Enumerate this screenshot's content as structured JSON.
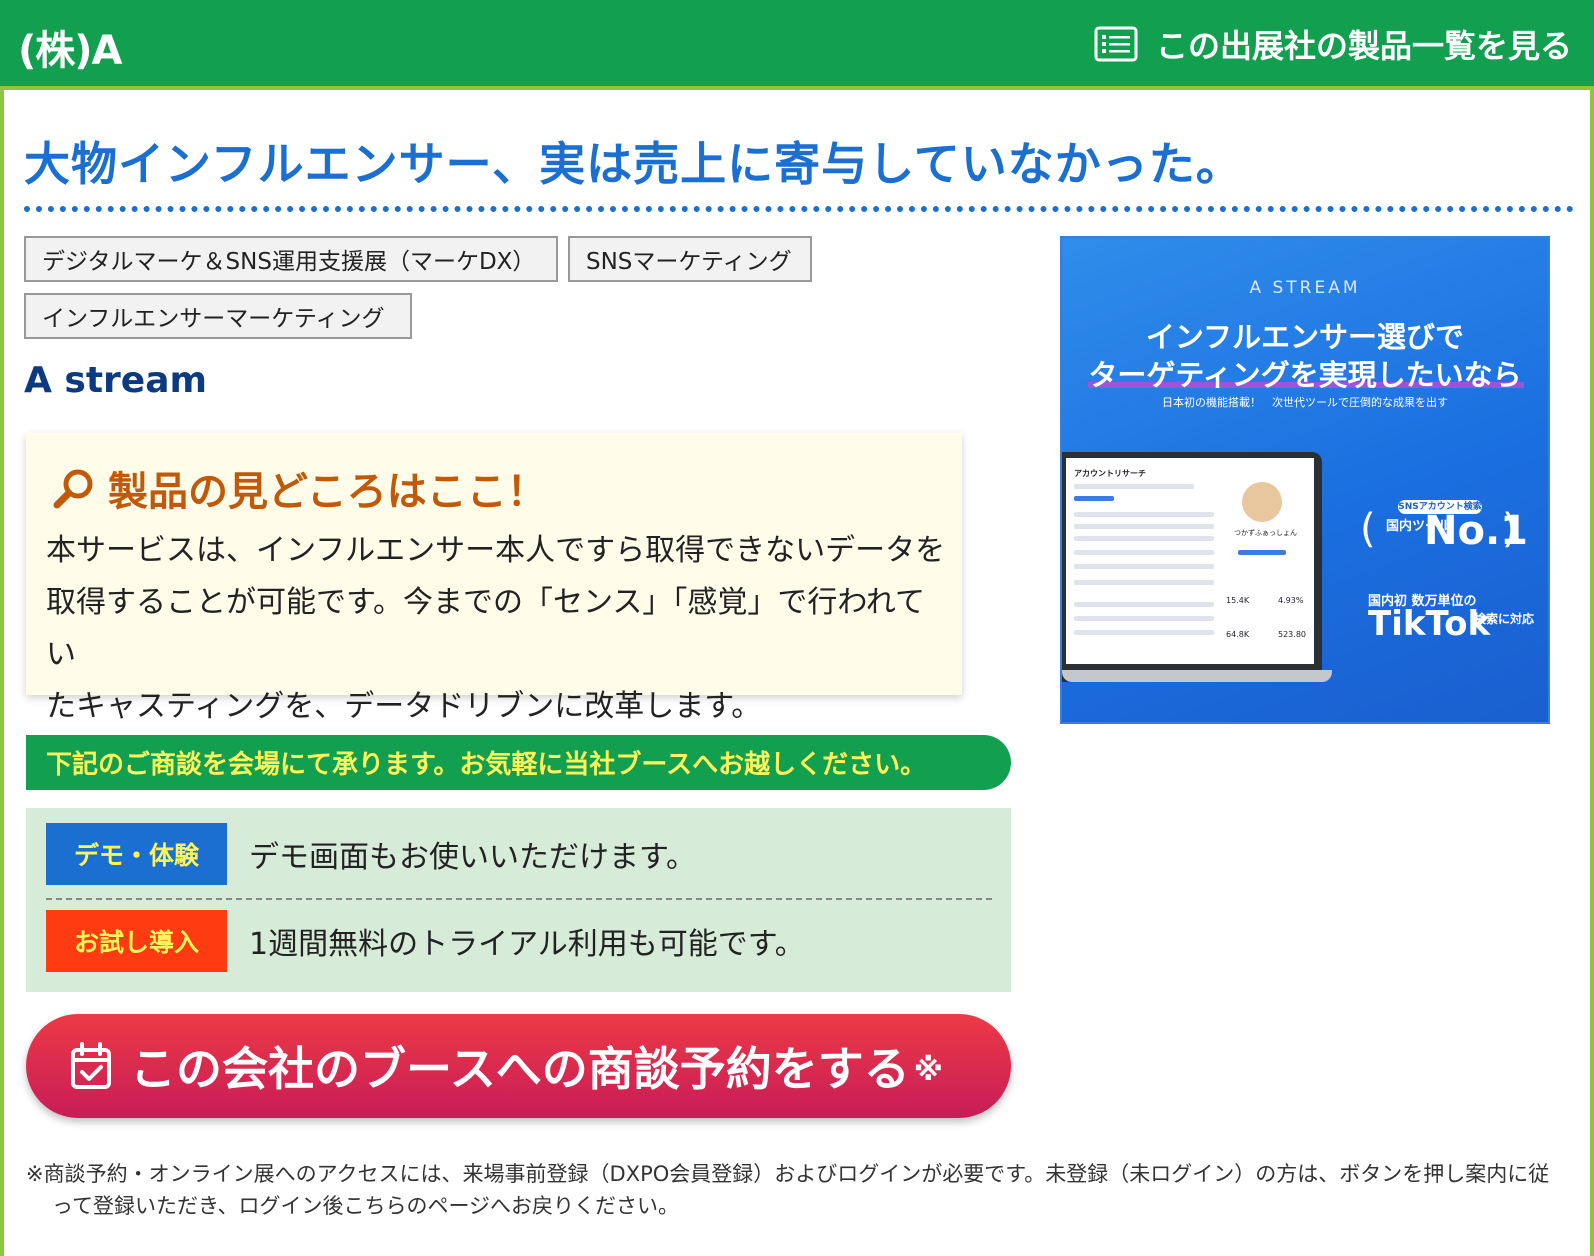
{
  "header": {
    "company": "(株)A",
    "products_link": "この出展社の製品一覧を見る"
  },
  "headline": "大物インフルエンサー、実は売上に寄与していなかった。",
  "tags": [
    "デジタルマーケ＆SNS運用支援展（マーケDX）",
    "SNSマーケティング",
    "インフルエンサーマーケティング"
  ],
  "product_name": "A stream",
  "highlight": {
    "title": "製品の見どころはここ！",
    "lines": [
      "本サービスは、インフルエンサー本人ですら取得できないデータを",
      "取得することが可能です。今までの「センス」「感覚」で行われてい",
      "たキャスティングを、データドリブンに改革します。"
    ]
  },
  "banner": {
    "brand": "A STREAM",
    "line1": "インフルエンサー選びで",
    "line2": "ターゲティングを実現したいなら",
    "sub": "日本初の機能搭載！　次世代ツールで圧倒的な成果を出す",
    "rank_badge": "SNSアカウント検索数",
    "rank_small": "国内ツール",
    "rank": "No.1",
    "tiktok_note": "国内初 数万単位の",
    "tiktok": "TikTok",
    "tiktok_sub": "検索に対応",
    "screen_title": "アカウントリサーチ",
    "screen_name": "つかずふぁっしょん",
    "stats": [
      "15.4K",
      "4.93%",
      "64.8K",
      "523.80"
    ]
  },
  "meeting": {
    "banner": "下記のご商談を会場にて承ります。お気軽に当社ブースへお越しください。",
    "items": [
      {
        "label": "デモ・体験",
        "text": "デモ画面もお使いいただけます。"
      },
      {
        "label": "お試し導入",
        "text": "1週間無料のトライアル利用も可能です。"
      }
    ]
  },
  "reserve_button": {
    "label": "この会社のブースへの商談予約をする",
    "mark": "※"
  },
  "footnote": "※商談予約・オンライン展へのアクセスには、来場事前登録（DXPO会員登録）およびログインが必要です。未登録（未ログイン）の方は、ボタンを押し案内に従って登録いただき、ログイン後こちらのページへお戻りください。",
  "colors": {
    "header_green": "#12a050",
    "frame_green": "#8cc63f",
    "headline_blue": "#1a6fd0",
    "highlight_orange": "#c05a0a",
    "demo_blue": "#1a6fd0",
    "trial_red": "#ff3c11",
    "label_yellow": "#fff45a",
    "reserve_red": "#e0304d"
  },
  "icons": {
    "products_link": "list-icon",
    "highlight": "magnifier-icon",
    "reserve": "calendar-check-icon"
  }
}
